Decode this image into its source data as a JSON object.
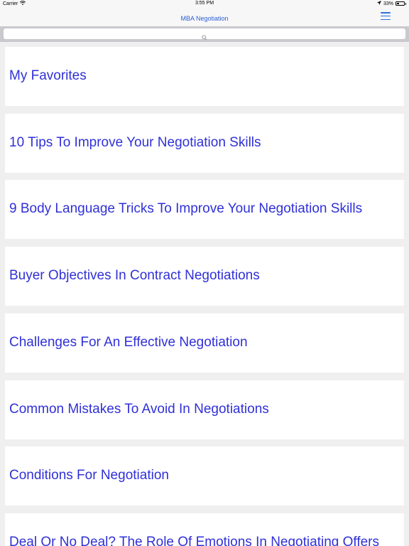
{
  "status_bar": {
    "carrier": "Carrier",
    "time": "3:55 PM",
    "battery": "33%",
    "battery_level": 0.33,
    "icons": [
      "wifi-icon",
      "location-arrow-icon",
      "battery-icon"
    ]
  },
  "nav": {
    "title": "MBA Negotiation",
    "menu_icon": "hamburger-menu-icon"
  },
  "search": {
    "placeholder": "",
    "value": "",
    "icon": "search-icon"
  },
  "colors": {
    "accent": "#2c6fe0",
    "item_text": "#3030d8",
    "background": "#efefef",
    "card": "#ffffff"
  },
  "items": [
    {
      "label": "My Favorites"
    },
    {
      "label": "10 Tips To Improve Your Negotiation Skills"
    },
    {
      "label": "9 Body Language Tricks To Improve Your Negotiation Skills"
    },
    {
      "label": "Buyer Objectives In Contract Negotiations"
    },
    {
      "label": "Challenges For An Effective Negotiation"
    },
    {
      "label": "Common Mistakes To Avoid In Negotiations"
    },
    {
      "label": "Conditions For Negotiation"
    },
    {
      "label": "Deal Or No Deal? The Role Of Emotions In Negotiating Offers"
    }
  ]
}
